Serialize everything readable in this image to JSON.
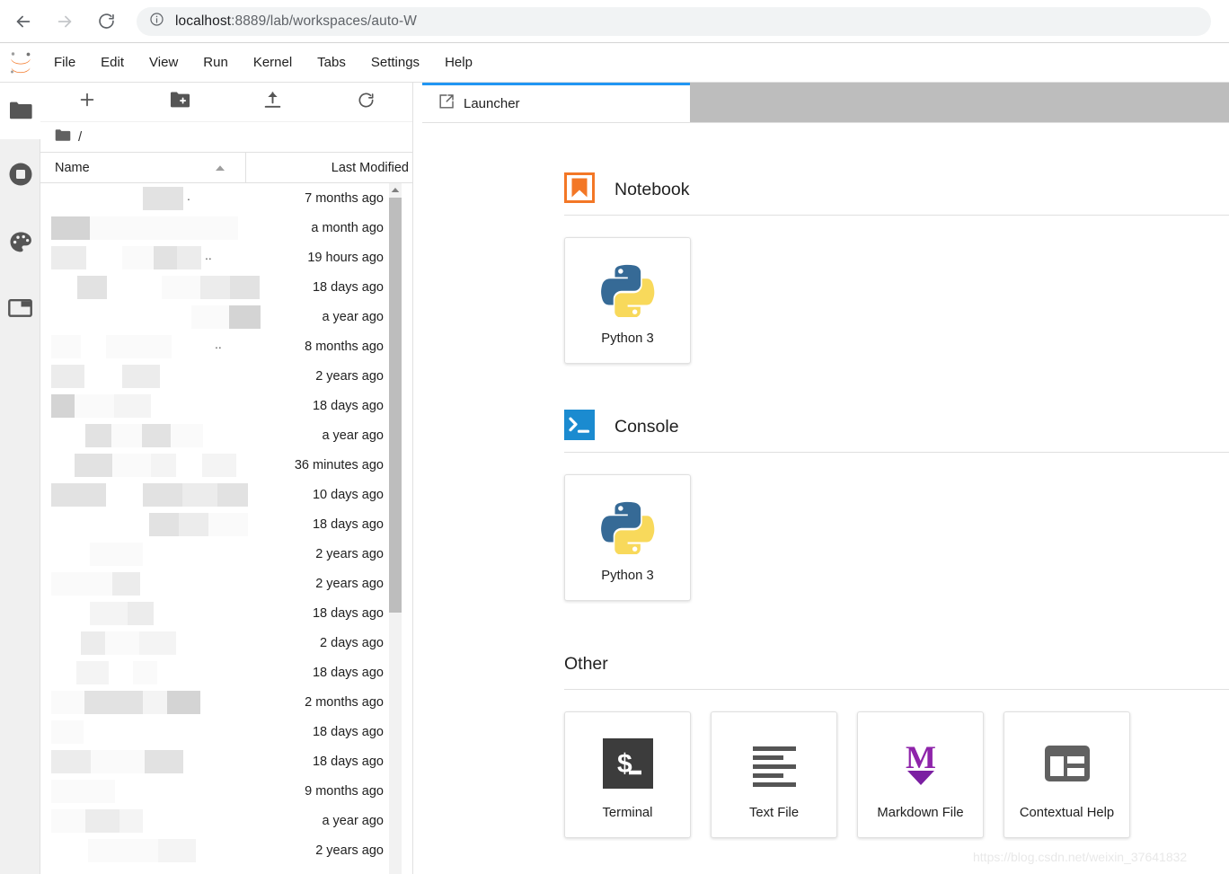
{
  "browser": {
    "back_icon": "back-arrow-icon",
    "forward_icon": "forward-arrow-icon",
    "reload_icon": "reload-icon",
    "info_icon": "info-circle-icon",
    "url_host": "localhost",
    "url_path": ":8889/lab/workspaces/auto-W",
    "url_full": "localhost:8889/lab/workspaces/auto-W"
  },
  "menubar": {
    "logo": "jupyter-logo",
    "items": [
      {
        "label": "File"
      },
      {
        "label": "Edit"
      },
      {
        "label": "View"
      },
      {
        "label": "Run"
      },
      {
        "label": "Kernel"
      },
      {
        "label": "Tabs"
      },
      {
        "label": "Settings"
      },
      {
        "label": "Help"
      }
    ]
  },
  "left_rail": {
    "items": [
      {
        "name": "file-browser",
        "icon": "folder-icon",
        "active": true
      },
      {
        "name": "running-terminals-kernels",
        "icon": "stop-circle-icon",
        "active": false
      },
      {
        "name": "extension-manager",
        "icon": "palette-icon",
        "active": false
      },
      {
        "name": "open-tabs",
        "icon": "tab-icon",
        "active": false
      }
    ]
  },
  "filebrowser": {
    "toolbar": [
      {
        "name": "new-launcher",
        "icon": "plus-icon"
      },
      {
        "name": "new-folder",
        "icon": "new-folder-icon"
      },
      {
        "name": "upload",
        "icon": "upload-icon"
      },
      {
        "name": "refresh",
        "icon": "refresh-icon"
      }
    ],
    "breadcrumb": {
      "root_icon": "folder-icon",
      "path": "/"
    },
    "columns": {
      "name": "Name",
      "last_modified": "Last Modified",
      "sort_icon": "caret-up-icon"
    },
    "rows": [
      {
        "name_masked": true,
        "suffix": ".",
        "modified": "7 months ago"
      },
      {
        "name_masked": true,
        "suffix": "",
        "modified": "a month ago"
      },
      {
        "name_masked": true,
        "suffix": "..",
        "modified": "19 hours ago"
      },
      {
        "name_masked": true,
        "suffix": "",
        "modified": "18 days ago"
      },
      {
        "name_masked": true,
        "suffix": "",
        "modified": "a year ago"
      },
      {
        "name_masked": true,
        "suffix": "..",
        "modified": "8 months ago"
      },
      {
        "name_masked": true,
        "suffix": "",
        "modified": "2 years ago"
      },
      {
        "name_masked": true,
        "suffix": "",
        "modified": "18 days ago"
      },
      {
        "name_masked": true,
        "suffix": "",
        "modified": "a year ago"
      },
      {
        "name_masked": true,
        "suffix": "",
        "modified": "36 minutes ago"
      },
      {
        "name_masked": true,
        "suffix": "",
        "modified": "10 days ago"
      },
      {
        "name_masked": true,
        "suffix": "",
        "modified": "18 days ago"
      },
      {
        "name_masked": true,
        "suffix": "",
        "modified": "2 years ago"
      },
      {
        "name_masked": true,
        "suffix": "",
        "modified": "2 years ago"
      },
      {
        "name_masked": true,
        "suffix": "",
        "modified": "18 days ago"
      },
      {
        "name_masked": true,
        "suffix": "",
        "modified": "2 days ago"
      },
      {
        "name_masked": true,
        "suffix": "",
        "modified": "18 days ago"
      },
      {
        "name_masked": true,
        "suffix": "",
        "modified": "2 months ago"
      },
      {
        "name_masked": true,
        "suffix": "",
        "modified": "18 days ago"
      },
      {
        "name_masked": true,
        "suffix": "",
        "modified": "18 days ago"
      },
      {
        "name_masked": true,
        "suffix": "",
        "modified": "9 months ago"
      },
      {
        "name_masked": true,
        "suffix": "",
        "modified": "a year ago"
      },
      {
        "name_masked": true,
        "suffix": "",
        "modified": "2 years ago"
      }
    ]
  },
  "tabbar": {
    "tabs": [
      {
        "label": "Launcher",
        "icon": "launcher-icon",
        "active": true
      }
    ]
  },
  "launcher": {
    "sections": [
      {
        "title": "Notebook",
        "icon": "notebook-ribbon-icon",
        "has_icon": true,
        "cards": [
          {
            "label": "Python 3",
            "icon": "python-logo-icon"
          }
        ]
      },
      {
        "title": "Console",
        "icon": "console-prompt-icon",
        "has_icon": true,
        "cards": [
          {
            "label": "Python 3",
            "icon": "python-logo-icon"
          }
        ]
      },
      {
        "title": "Other",
        "icon": "",
        "has_icon": false,
        "cards": [
          {
            "label": "Terminal",
            "icon": "terminal-icon"
          },
          {
            "label": "Text File",
            "icon": "text-file-icon"
          },
          {
            "label": "Markdown File",
            "icon": "markdown-icon"
          },
          {
            "label": "Contextual Help",
            "icon": "contextual-help-icon"
          }
        ]
      }
    ]
  },
  "watermark": {
    "text": "https://blog.csdn.net/weixin_37641832"
  },
  "colors": {
    "accent_blue": "#2196f3",
    "jupyter_orange": "#f37726",
    "console_blue": "#1b8bd0",
    "markdown_purple": "#7b1fa2",
    "terminal_dark": "#3c3c3c",
    "tabbar_gray": "#bdbdbd"
  }
}
